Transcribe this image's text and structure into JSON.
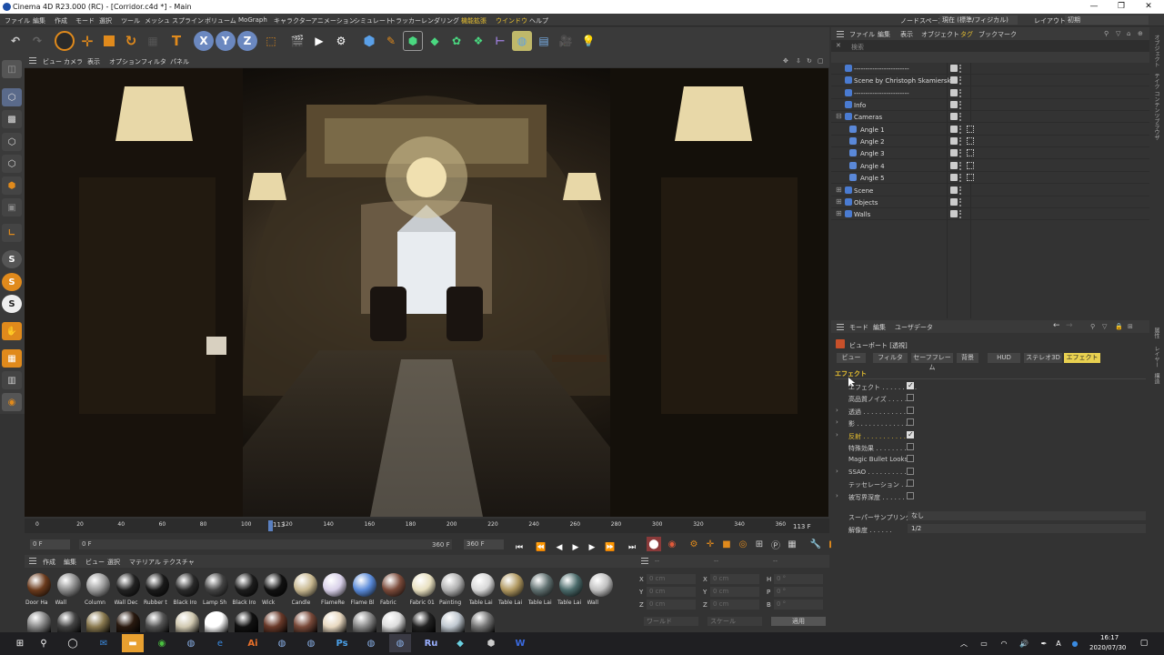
{
  "window": {
    "title": "Cinema 4D R23.000 (RC) - [Corridor.c4d *] - Main",
    "min": "—",
    "max": "❐",
    "close": "✕"
  },
  "menu": {
    "items": [
      "ファイル",
      "編集",
      "作成",
      "モード",
      "選択",
      "ツール",
      "メッシュ",
      "スプライン",
      "ボリューム",
      "MoGraph",
      "キャラクター",
      "アニメーション",
      "シミュレート",
      "トラッカー",
      "レンダリング",
      "機能拡張",
      "ウインドウ",
      "ヘルプ"
    ],
    "nodespace_label": "ノードスペース:",
    "nodespace_value": "現在 (標準/フィジカル)",
    "layout_label": "レイアウト:",
    "layout_value": "初期"
  },
  "toolbar": {
    "undo": "↶",
    "redo": "↷",
    "x": "X",
    "y": "Y",
    "z": "Z",
    "text_tool": "T"
  },
  "viewport_menu": {
    "items": [
      "ビュー",
      "カメラ",
      "表示",
      "オプション",
      "フィルタ",
      "パネル"
    ]
  },
  "timeline": {
    "ticks": [
      "0",
      "20",
      "40",
      "60",
      "80",
      "100",
      "120",
      "140",
      "160",
      "180",
      "200",
      "220",
      "240",
      "260",
      "280",
      "300",
      "320",
      "340",
      "360"
    ],
    "current_frame": "113",
    "current_display": "113 F",
    "start": "0 F",
    "start2": "0 F",
    "end": "360 F",
    "end2": "360 F"
  },
  "materials": {
    "menu": [
      "作成",
      "編集",
      "ビュー",
      "選択",
      "マテリアル",
      "テクスチャ"
    ],
    "items": [
      {
        "label": "Door Ha",
        "c": "#6a3a1c"
      },
      {
        "label": "Wall",
        "c": "#8a8a8a"
      },
      {
        "label": "Column",
        "c": "#9a9a9a"
      },
      {
        "label": "Wall Dec",
        "c": "#222"
      },
      {
        "label": "Rubber t",
        "c": "#1a1a1a"
      },
      {
        "label": "Black Iro",
        "c": "#2a2a2a"
      },
      {
        "label": "Lamp Sh",
        "c": "#444"
      },
      {
        "label": "Black Iro",
        "c": "#1c1c1c"
      },
      {
        "label": "Wick",
        "c": "#111"
      },
      {
        "label": "Candle",
        "c": "#c8b890"
      },
      {
        "label": "FlameRe",
        "c": "#d8d0e8"
      },
      {
        "label": "Flame Bl",
        "c": "#5a8ad8"
      },
      {
        "label": "Fabric",
        "c": "#7a4a3a"
      },
      {
        "label": "Fabric 01",
        "c": "#e8e0c0"
      },
      {
        "label": "Painting",
        "c": "#b0b0b0"
      },
      {
        "label": "Table Lai",
        "c": "#d8d8d8"
      },
      {
        "label": "Table Lai",
        "c": "#b09860"
      },
      {
        "label": "Table Lai",
        "c": "#607070"
      },
      {
        "label": "Table Lai",
        "c": "#4a6a6a"
      },
      {
        "label": "Wall",
        "c": "#c0c0c0"
      }
    ],
    "row2": [
      "#888",
      "#444",
      "#8a7a50",
      "#2a1a10",
      "#555",
      "#d0c8b0",
      "#fff",
      "#111",
      "#6a3a2a",
      "#7a4a3a",
      "#e8d8c0",
      "#888",
      "#ddd",
      "#222",
      "#c0c8d0",
      "#777"
    ]
  },
  "coords": {
    "rows": [
      [
        "X",
        "0 cm",
        "X",
        "0 cm",
        "H",
        "0 °"
      ],
      [
        "Y",
        "0 cm",
        "Y",
        "0 cm",
        "P",
        "0 °"
      ],
      [
        "Z",
        "0 cm",
        "Z",
        "0 cm",
        "B",
        "0 °"
      ]
    ],
    "world": "ワールド",
    "scale": "スケール",
    "apply": "適用",
    "hdr": [
      "--",
      "--",
      "--"
    ]
  },
  "objects": {
    "menu": [
      "ファイル",
      "編集",
      "表示",
      "オブジェクト",
      "タグ",
      "ブックマーク"
    ],
    "search": "検索",
    "rows": [
      {
        "name": "------------------------",
        "indent": 0
      },
      {
        "name": "Scene by Christoph Skamierski",
        "indent": 0
      },
      {
        "name": "------------------------",
        "indent": 0
      },
      {
        "name": "Info",
        "indent": 0
      },
      {
        "name": "Cameras",
        "indent": 0
      },
      {
        "name": "Angle 1",
        "indent": 1
      },
      {
        "name": "Angle 2",
        "indent": 1
      },
      {
        "name": "Angle 3",
        "indent": 1
      },
      {
        "name": "Angle 4",
        "indent": 1
      },
      {
        "name": "Angle 5",
        "indent": 1
      },
      {
        "name": "Scene",
        "indent": 0
      },
      {
        "name": "Objects",
        "indent": 0
      },
      {
        "name": "Walls",
        "indent": 0
      }
    ]
  },
  "attributes": {
    "menu": [
      "モード",
      "編集",
      "ユーザデータ"
    ],
    "title": "ビューポート [透視]",
    "tabs": [
      "ビュー",
      "フィルタ",
      "セーフフレーム",
      "背景",
      "HUD",
      "ステレオ3D",
      "エフェクト"
    ],
    "section": "エフェクト",
    "rows": [
      {
        "label": "エフェクト . . . . . . . . .",
        "on": true,
        "arrow": false
      },
      {
        "label": "高品質ノイズ . . . . .",
        "on": false,
        "arrow": false
      },
      {
        "label": "透過 . . . . . . . . . . . .",
        "on": false,
        "arrow": true
      },
      {
        "label": "影 . . . . . . . . . . . . . .",
        "on": false,
        "arrow": true
      },
      {
        "label": "反射 . . . . . . . . . . . .",
        "on": true,
        "arrow": true
      },
      {
        "label": "特殊効果 . . . . . . . .",
        "on": false,
        "arrow": false
      },
      {
        "label": "Magic Bullet Looks",
        "on": false,
        "arrow": false
      },
      {
        "label": "SSAO . . . . . . . . . .",
        "on": false,
        "arrow": true
      },
      {
        "label": "テッセレーション . . .",
        "on": false,
        "arrow": false
      },
      {
        "label": "被写界深度 . . . . . .",
        "on": false,
        "arrow": true
      }
    ],
    "supersampling_label": "スーパーサンプリング",
    "supersampling_value": "なし",
    "resolution_label": "解像度 . . . . . .",
    "resolution_value": "1/2"
  },
  "sidetabs": {
    "top": [
      "オブジェクト",
      "テイク",
      "コンテンツブラウザ"
    ],
    "bottom": [
      "属性",
      "レイヤー",
      "構造"
    ]
  },
  "taskbar": {
    "time": "16:17",
    "date": "2020/07/30"
  }
}
